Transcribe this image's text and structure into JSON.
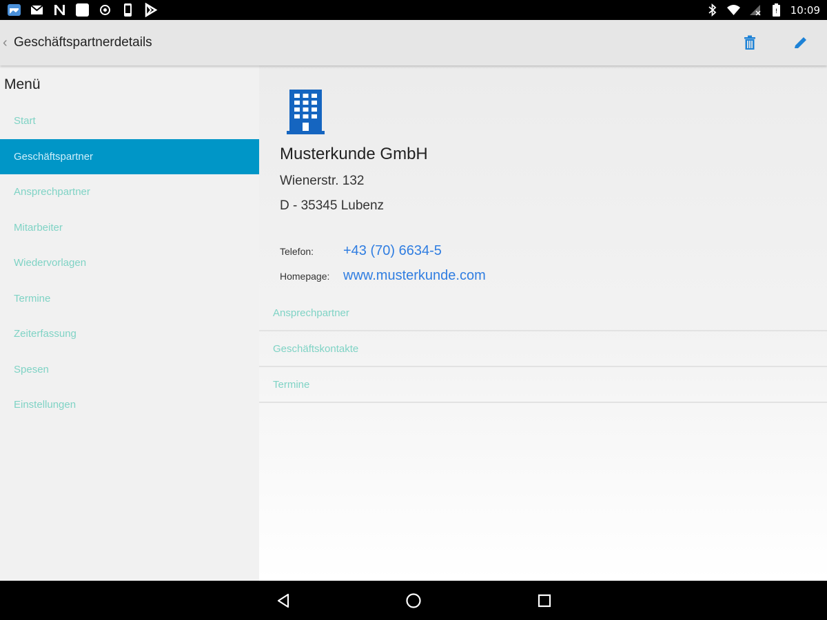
{
  "status_bar": {
    "left_icons": [
      "gallery-notification-icon",
      "gmail-icon",
      "n-app-icon",
      "white-square-icon",
      "record-icon",
      "phone-icon",
      "play-store-icon"
    ],
    "right_icons": [
      "bluetooth-icon",
      "wifi-icon",
      "no-sim-icon",
      "battery-icon"
    ],
    "time": "10:09"
  },
  "app_bar": {
    "back_glyph": "‹",
    "title": "Geschäftspartnerdetails",
    "actions": [
      "delete-icon",
      "edit-icon"
    ],
    "accent_color": "#2f7de1"
  },
  "sidebar": {
    "title": "Menü",
    "items": [
      {
        "label": "Start"
      },
      {
        "label": "Geschäftspartner",
        "active": true
      },
      {
        "label": "Ansprechpartner"
      },
      {
        "label": "Mitarbeiter"
      },
      {
        "label": "Wiedervorlagen"
      },
      {
        "label": "Termine"
      },
      {
        "label": "Zeiterfassung"
      },
      {
        "label": "Spesen"
      },
      {
        "label": "Einstellungen"
      }
    ],
    "active_color": "#0096c7",
    "item_color": "#7fd3c5"
  },
  "partner": {
    "icon": "building-icon",
    "name": "Musterkunde GmbH",
    "street": "Wienerstr. 132",
    "city": "D - 35345 Lubenz",
    "phone_label": "Telefon:",
    "phone": "+43 (70) 6634-5",
    "homepage_label": "Homepage:",
    "homepage": "www.musterkunde.com"
  },
  "sections": [
    {
      "label": "Ansprechpartner"
    },
    {
      "label": "Geschäftskontakte"
    },
    {
      "label": "Termine"
    }
  ],
  "nav_bar": [
    "back-triangle-icon",
    "home-circle-icon",
    "recents-square-icon"
  ]
}
